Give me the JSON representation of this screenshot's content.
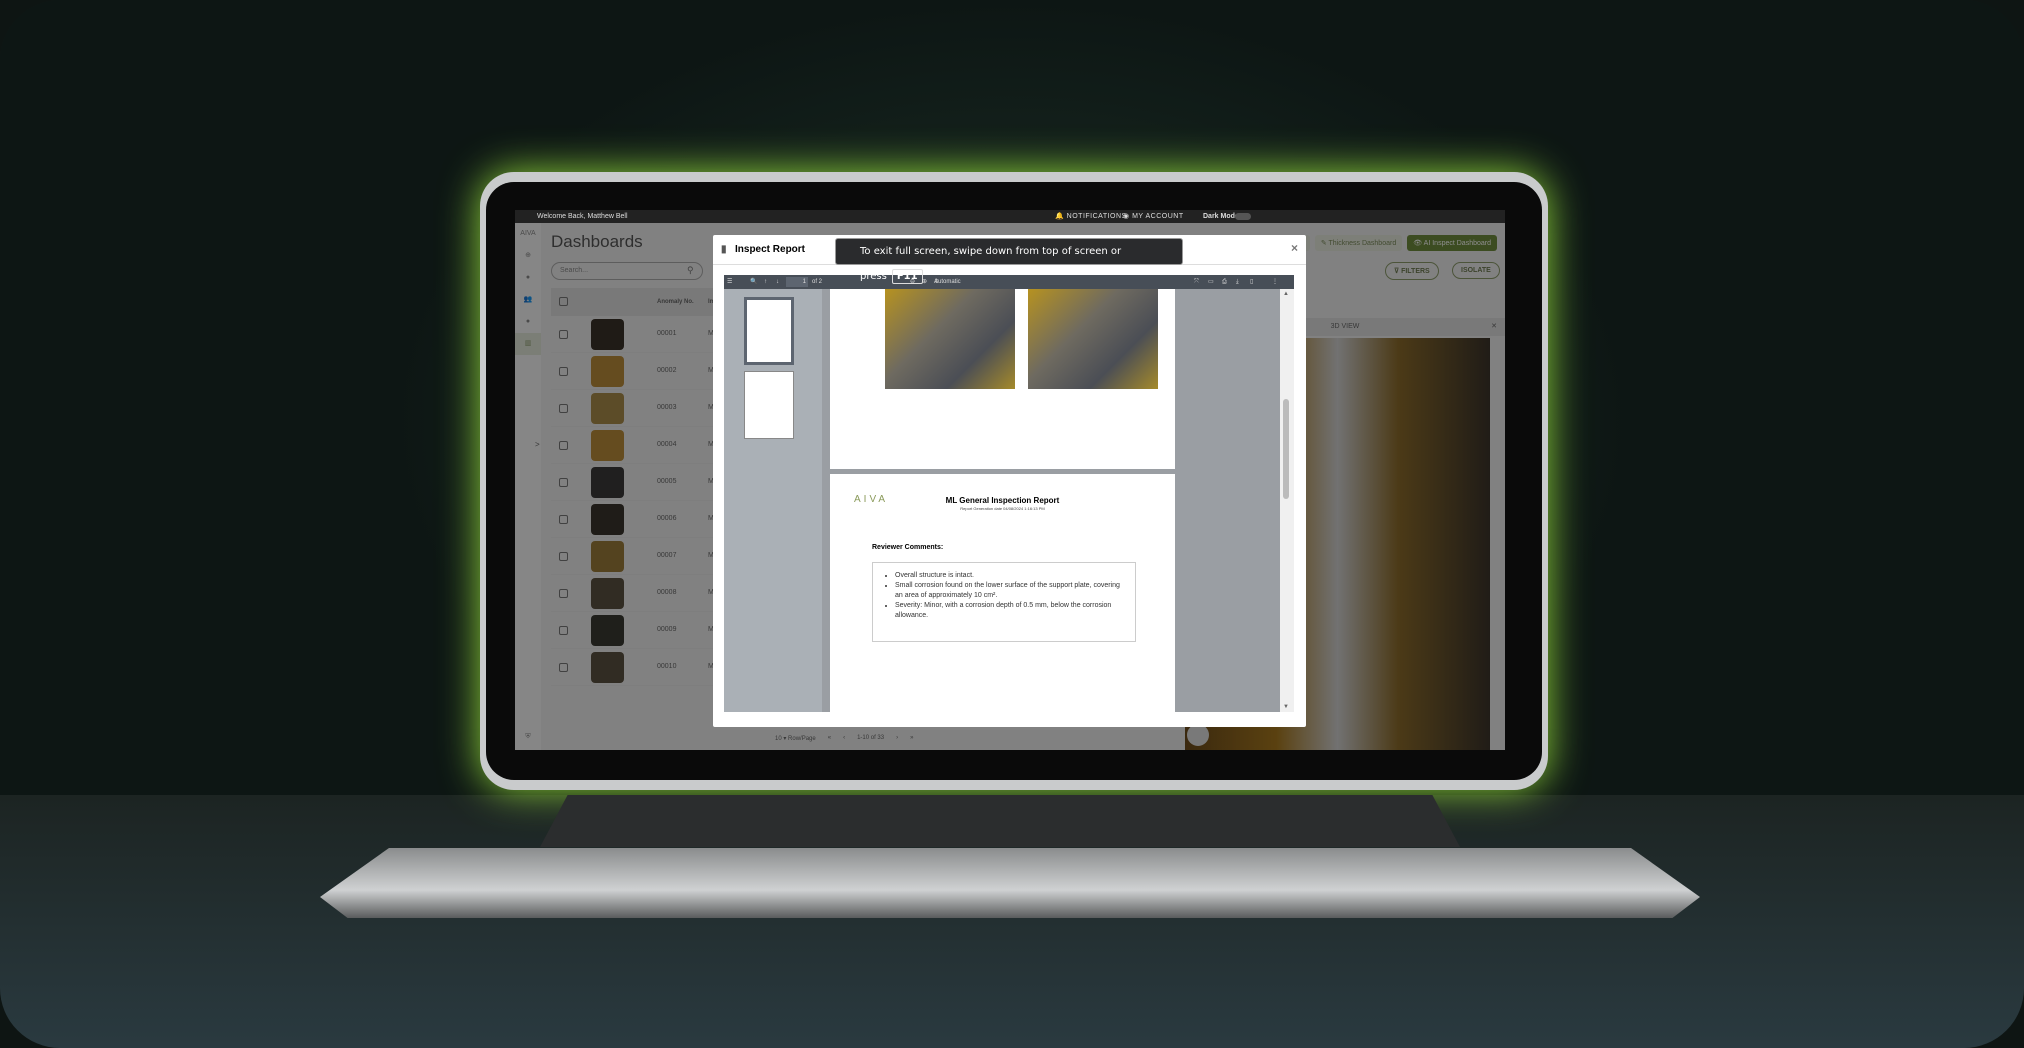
{
  "topbar": {
    "welcome": "Welcome Back, Matthew Bell",
    "notifications": "NOTIFICATIONS",
    "account": "MY ACCOUNT",
    "dark_mode": "Dark Mode"
  },
  "sidebar": {
    "logo": "AIVA",
    "expand": ">"
  },
  "page": {
    "title": "Dashboards",
    "search_placeholder": "Search..."
  },
  "nav_buttons": [
    "d",
    "Thickness Dashboard",
    "AI Inspect Dashboard"
  ],
  "actions": {
    "filters": "FILTERS",
    "isolate": "ISOLATE"
  },
  "table": {
    "headers": [
      "Anomaly No.",
      "Im"
    ],
    "rows": [
      {
        "id": "00001",
        "col2": "Me",
        "color": "#3a3228"
      },
      {
        "id": "00002",
        "col2": "Me",
        "color": "#b98a3a"
      },
      {
        "id": "00003",
        "col2": "Me",
        "color": "#a88a4a"
      },
      {
        "id": "00004",
        "col2": "Me",
        "color": "#b98a3a"
      },
      {
        "id": "00005",
        "col2": "Me",
        "color": "#3b3a3a"
      },
      {
        "id": "00006",
        "col2": "Me",
        "color": "#3a342c"
      },
      {
        "id": "00007",
        "col2": "Me",
        "color": "#9a7a3a"
      },
      {
        "id": "00008",
        "col2": "Me",
        "color": "#5a5040"
      },
      {
        "id": "00009",
        "col2": "Me",
        "color": "#3a3a32"
      },
      {
        "id": "00010",
        "col2": "Me",
        "color": "#5a5040"
      }
    ]
  },
  "pagination": {
    "rows_per_page": "10",
    "rows_label": "Row/Page",
    "range": "1-10 of 33"
  },
  "view_panel": {
    "tab": "3D VIEW"
  },
  "modal": {
    "title": "Inspect Report",
    "close": "×"
  },
  "toast": {
    "text": "To exit full screen, swipe down from top of screen or press",
    "key": "F11"
  },
  "pdf": {
    "page_current": "1",
    "page_total": "of 2",
    "zoom": "Automatic Zoom",
    "logo": "AIVA",
    "report_title": "ML General Inspection Report",
    "report_date": "Report Generation date 04/08/2024 1:16:13 PM",
    "comments_heading": "Reviewer Comments:",
    "comments": [
      "Overall structure is intact.",
      "Small corrosion found on the lower surface of the support plate, covering an area of approximately 10 cm².",
      "Severity: Minor, with a corrosion depth of 0.5 mm, below the corrosion allowance."
    ]
  },
  "colors": {
    "accent": "#6e8a3c",
    "glow": "#8fd43a"
  }
}
